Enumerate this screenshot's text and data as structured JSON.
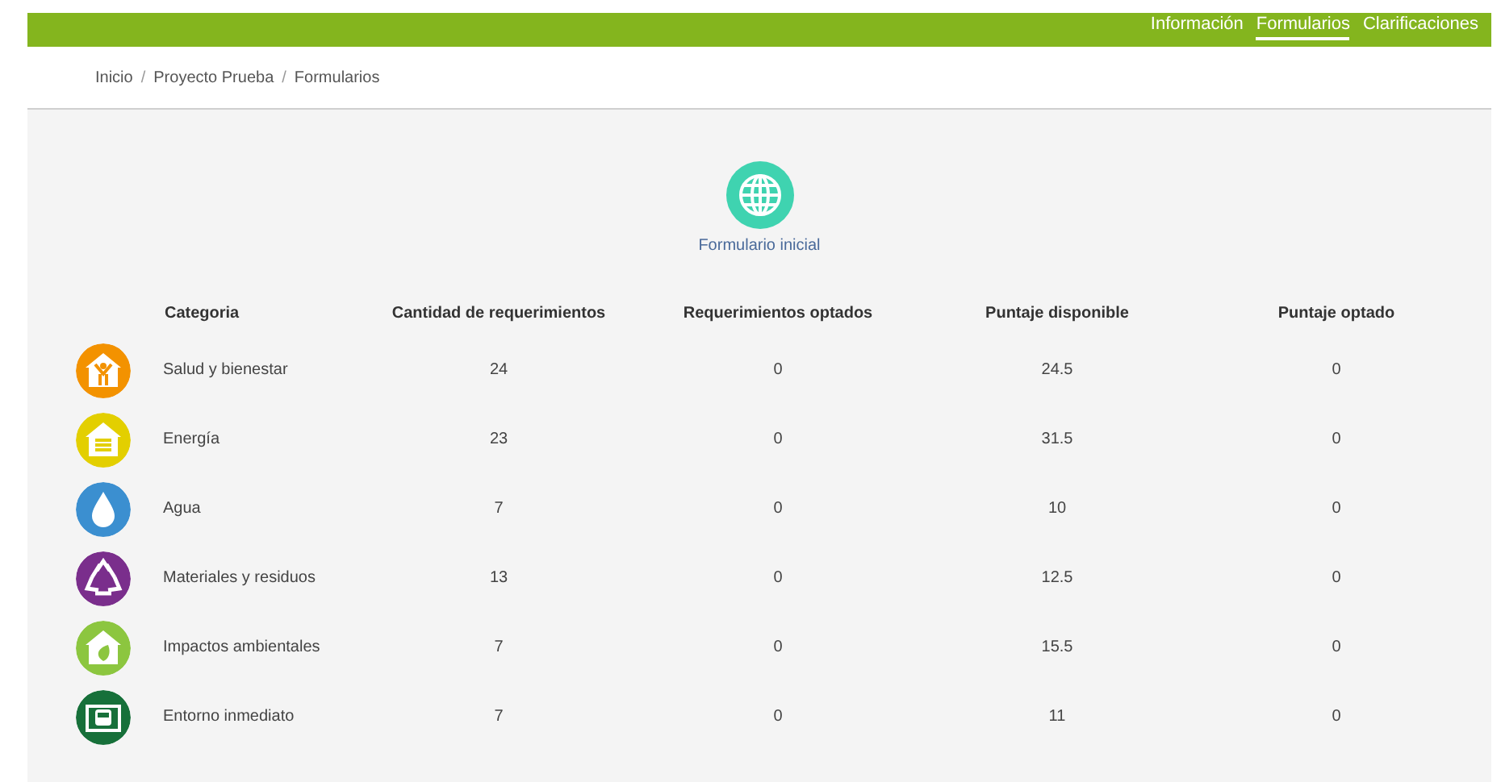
{
  "nav": [
    {
      "label": "Información",
      "selected": false
    },
    {
      "label": "Formularios",
      "selected": true
    },
    {
      "label": "Clarificaciones",
      "selected": false
    }
  ],
  "breadcrumb": [
    "Inicio",
    "Proyecto Prueba",
    "Formularios"
  ],
  "breadcrumb_separators": [
    "/",
    "/"
  ],
  "form": {
    "label": "Formulario inicial"
  },
  "table": {
    "columns": [
      "Categoria",
      "Cantidad de requerimientos",
      "Requerimientos optados",
      "Puntaje disponible",
      "Puntaje optado"
    ],
    "rows": [
      {
        "kind": "health",
        "color": "#f39200",
        "cells": [
          "Salud y bienestar",
          "24",
          "0",
          "24.5",
          "0"
        ]
      },
      {
        "kind": "energy",
        "color": "#e3cf00",
        "cells": [
          "Energía",
          "23",
          "0",
          "31.5",
          "0"
        ]
      },
      {
        "kind": "water",
        "color": "#3b8fd0",
        "cells": [
          "Agua",
          "7",
          "0",
          "10",
          "0"
        ]
      },
      {
        "kind": "materials",
        "color": "#7a2e8c",
        "cells": [
          "Materiales y residuos",
          "13",
          "0",
          "12.5",
          "0"
        ]
      },
      {
        "kind": "environment",
        "color": "#8cc63f",
        "cells": [
          "Impactos ambientales",
          "7",
          "0",
          "15.5",
          "0"
        ]
      },
      {
        "kind": "surroundings",
        "color": "#17703a",
        "cells": [
          "Entorno inmediato",
          "7",
          "0",
          "11",
          "0"
        ]
      }
    ]
  }
}
